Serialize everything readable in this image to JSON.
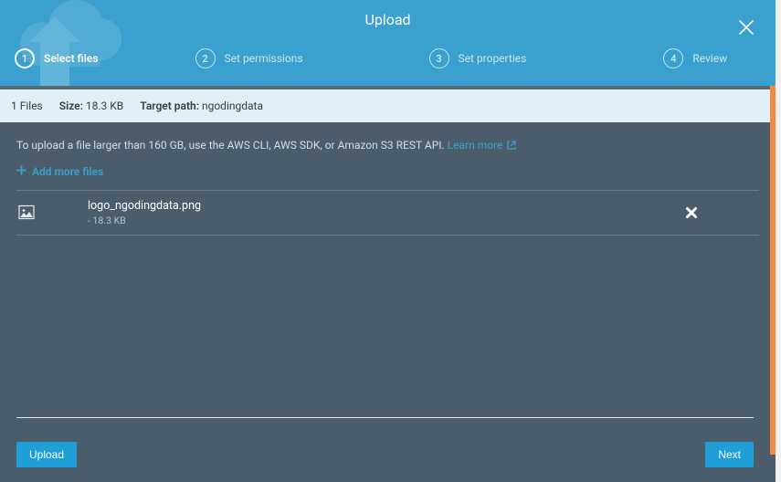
{
  "title": "Upload",
  "steps": [
    {
      "num": "1",
      "label": "Select files",
      "active": true
    },
    {
      "num": "2",
      "label": "Set permissions",
      "active": false
    },
    {
      "num": "3",
      "label": "Set properties",
      "active": false
    },
    {
      "num": "4",
      "label": "Review",
      "active": false
    }
  ],
  "info": {
    "filesCount": "1 Files",
    "sizeLabel": "Size:",
    "sizeValue": "18.3 KB",
    "targetLabel": "Target path:",
    "targetValue": "ngodingdata"
  },
  "notice": {
    "text": "To upload a file larger than 160 GB, use the AWS CLI, AWS SDK, or Amazon S3 REST API. ",
    "linkText": "Learn more"
  },
  "addMoreLabel": "Add more files",
  "files": [
    {
      "name": "logo_ngodingdata.png",
      "size": "- 18.3 KB"
    }
  ],
  "buttons": {
    "upload": "Upload",
    "next": "Next"
  }
}
